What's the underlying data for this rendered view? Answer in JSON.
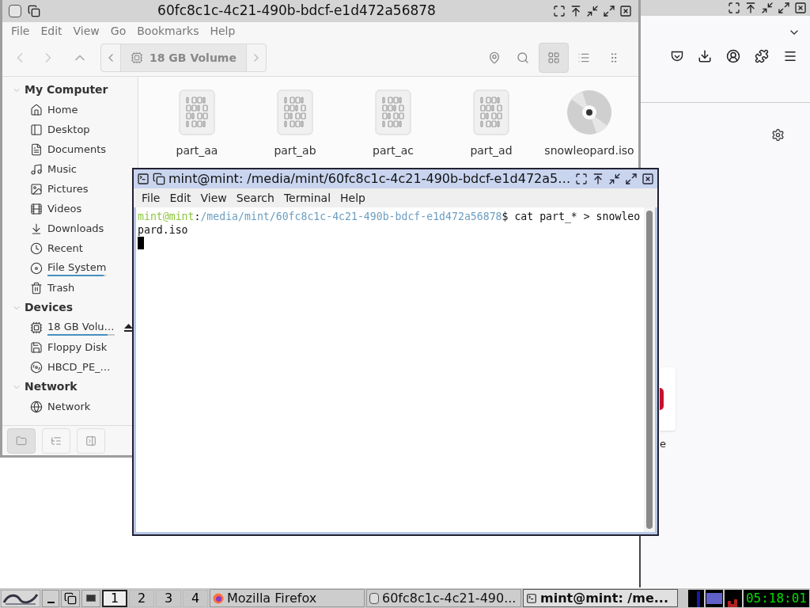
{
  "file_manager": {
    "title": "60fc8c1c-4c21-490b-bdcf-e1d472a56878",
    "menu": [
      "File",
      "Edit",
      "View",
      "Go",
      "Bookmarks",
      "Help"
    ],
    "location": "18 GB Volume",
    "view_modes": [
      {
        "kind": "grid",
        "selected": true
      },
      {
        "kind": "list",
        "selected": false
      },
      {
        "kind": "compact",
        "selected": false
      }
    ],
    "sidebar": [
      {
        "title": "My Computer",
        "expanded": true,
        "items": [
          {
            "label": "Home",
            "kind": "home"
          },
          {
            "label": "Desktop",
            "kind": "desktop"
          },
          {
            "label": "Documents",
            "kind": "documents"
          },
          {
            "label": "Music",
            "kind": "music"
          },
          {
            "label": "Pictures",
            "kind": "pictures"
          },
          {
            "label": "Videos",
            "kind": "videos"
          },
          {
            "label": "Downloads",
            "kind": "downloads"
          },
          {
            "label": "Recent",
            "kind": "recent"
          },
          {
            "label": "File System",
            "kind": "filesystem",
            "level": 0.95
          },
          {
            "label": "Trash",
            "kind": "trash"
          }
        ]
      },
      {
        "title": "Devices",
        "expanded": true,
        "items": [
          {
            "label": "18 GB Volu…",
            "kind": "volume",
            "level": 0.9,
            "ejectable": true
          },
          {
            "label": "Floppy Disk",
            "kind": "floppy"
          },
          {
            "label": "HBCD_PE_…",
            "kind": "disc"
          }
        ]
      },
      {
        "title": "Network",
        "expanded": true,
        "items": [
          {
            "label": "Network",
            "kind": "network"
          }
        ]
      }
    ],
    "bottom_buttons": [
      {
        "kind": "places",
        "selected": true
      },
      {
        "kind": "tree",
        "selected": false
      },
      {
        "kind": "close",
        "selected": false
      }
    ],
    "files": [
      {
        "name": "part_aa",
        "kind": "binary"
      },
      {
        "name": "part_ab",
        "kind": "binary"
      },
      {
        "name": "part_ac",
        "kind": "binary"
      },
      {
        "name": "part_ad",
        "kind": "binary"
      },
      {
        "name": "snowleopard.iso",
        "kind": "disc"
      }
    ]
  },
  "terminal": {
    "title": "mint@mint: /media/mint/60fc8c1c-4c21-490b-bdcf-e1d472a5…",
    "menu": [
      "File",
      "Edit",
      "View",
      "Search",
      "Terminal",
      "Help"
    ],
    "lines": [
      [
        {
          "text": "mint@mint",
          "kind": "user"
        },
        {
          "text": ":",
          "kind": "plain"
        },
        {
          "text": "/media/mint/60fc8c1c-4c21-490b-bdcf-e1d472a56878",
          "kind": "path"
        },
        {
          "text": "$ cat part_* > snowleo",
          "kind": "plain"
        }
      ],
      [
        {
          "text": "pard.iso",
          "kind": "plain"
        }
      ]
    ],
    "cursor": true
  },
  "browser": {
    "partial_text": "e"
  },
  "taskbar": {
    "workspaces": [
      {
        "label": "1",
        "selected": true
      },
      {
        "label": "2",
        "selected": false
      },
      {
        "label": "3",
        "selected": false
      },
      {
        "label": "4",
        "selected": false
      }
    ],
    "tasks": [
      {
        "label": "Mozilla Firefox",
        "kind": "firefox",
        "selected": false
      },
      {
        "label": "60fc8c1c-4c21-490...",
        "kind": "files",
        "selected": false
      },
      {
        "label": "mint@mint: /me...",
        "kind": "terminal",
        "selected": true
      }
    ],
    "clock": "05:18:01"
  }
}
